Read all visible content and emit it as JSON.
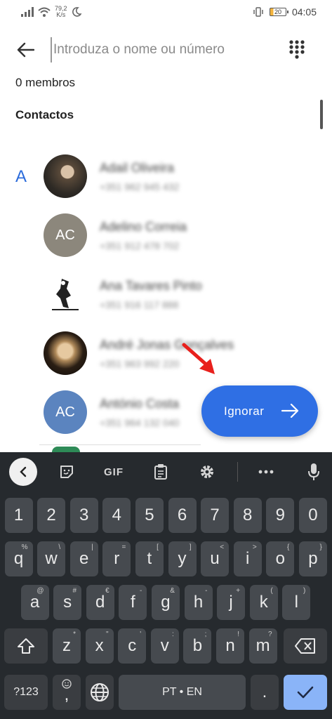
{
  "status_bar": {
    "net_speed_value": "79,2",
    "net_speed_unit": "K/s",
    "battery": "20",
    "time": "04:05"
  },
  "search": {
    "placeholder": "Introduza o nome ou número"
  },
  "member_count": "0 membros",
  "section_title": "Contactos",
  "index_letter": "A",
  "contacts": [
    {
      "name": "Adail Oliveira",
      "phone": "+351 962 945 432",
      "avatar_type": "photo"
    },
    {
      "name": "Adelino Correia",
      "phone": "+351 912 478 702",
      "avatar_type": "initials",
      "initials": "AC",
      "avatar_color": "#8c877c"
    },
    {
      "name": "Ana Tavares Pinto",
      "phone": "+351 916 117 888",
      "avatar_type": "drawing"
    },
    {
      "name": "André Jonas Gonçalves",
      "phone": "+351 963 992 220",
      "avatar_type": "photo"
    },
    {
      "name": "António Costa",
      "phone": "+351 964 132 040",
      "avatar_type": "initials",
      "initials": "AC",
      "avatar_color": "#5b84bf"
    }
  ],
  "skip_button": {
    "label": "Ignorar",
    "color": "#2f6fe4"
  },
  "keyboard": {
    "toolbar": {
      "gif_label": "GIF"
    },
    "row_numbers": [
      "1",
      "2",
      "3",
      "4",
      "5",
      "6",
      "7",
      "8",
      "9",
      "0"
    ],
    "row_top": [
      {
        "key": "q",
        "hint": "%"
      },
      {
        "key": "w",
        "hint": "\\"
      },
      {
        "key": "e",
        "hint": "|"
      },
      {
        "key": "r",
        "hint": "="
      },
      {
        "key": "t",
        "hint": "["
      },
      {
        "key": "y",
        "hint": "]"
      },
      {
        "key": "u",
        "hint": "<"
      },
      {
        "key": "i",
        "hint": ">"
      },
      {
        "key": "o",
        "hint": "{"
      },
      {
        "key": "p",
        "hint": "}"
      }
    ],
    "row_middle": [
      {
        "key": "a",
        "hint": "@"
      },
      {
        "key": "s",
        "hint": "#"
      },
      {
        "key": "d",
        "hint": "€"
      },
      {
        "key": "f",
        "hint": "-"
      },
      {
        "key": "g",
        "hint": "&"
      },
      {
        "key": "h",
        "hint": "-"
      },
      {
        "key": "j",
        "hint": "+"
      },
      {
        "key": "k",
        "hint": "("
      },
      {
        "key": "l",
        "hint": ")"
      }
    ],
    "row_bottom": [
      {
        "key": "z",
        "hint": "*"
      },
      {
        "key": "x",
        "hint": "\""
      },
      {
        "key": "c",
        "hint": "'"
      },
      {
        "key": "v",
        "hint": ":"
      },
      {
        "key": "b",
        "hint": ";"
      },
      {
        "key": "n",
        "hint": "!"
      },
      {
        "key": "m",
        "hint": "?"
      }
    ],
    "symbols_key": "?123",
    "comma_key": ",",
    "space_label": "PT • EN",
    "period_key": "."
  }
}
